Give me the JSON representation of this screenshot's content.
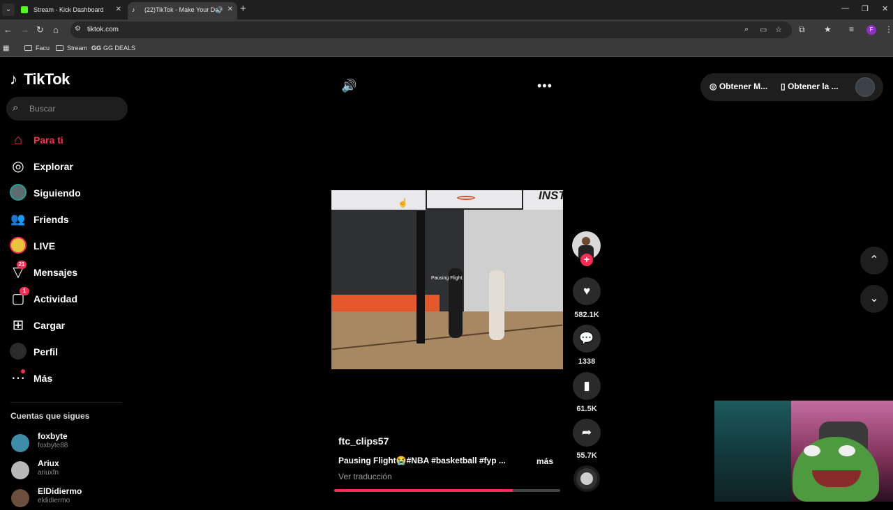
{
  "browser": {
    "tabs": [
      {
        "title": "Stream - Kick Dashboard",
        "favicon_color": "#53fc18",
        "active": false
      },
      {
        "title": "(22)TikTok - Make Your Day",
        "favicon_color": "#ffffff",
        "active": true
      }
    ],
    "url": "tiktok.com",
    "bookmarks": [
      {
        "label": "Facu",
        "icon": "folder-icon"
      },
      {
        "label": "Stream",
        "icon": "folder-icon"
      },
      {
        "label": "GG DEALS",
        "icon": "gg-icon"
      }
    ],
    "profile_initial": "F"
  },
  "sidebar": {
    "logo": "TikTok",
    "search_placeholder": "Buscar",
    "items": [
      {
        "label": "Para ti",
        "icon": "home-icon",
        "active": true
      },
      {
        "label": "Explorar",
        "icon": "compass-icon"
      },
      {
        "label": "Siguiendo",
        "icon": "following-avatar"
      },
      {
        "label": "Friends",
        "icon": "friends-icon"
      },
      {
        "label": "LIVE",
        "icon": "live-avatar"
      },
      {
        "label": "Mensajes",
        "icon": "send-icon",
        "badge": "21"
      },
      {
        "label": "Actividad",
        "icon": "activity-icon",
        "badge": "1"
      },
      {
        "label": "Cargar",
        "icon": "upload-icon"
      },
      {
        "label": "Perfil",
        "icon": "profile-avatar"
      },
      {
        "label": "Más",
        "icon": "more-icon"
      }
    ],
    "following_title": "Cuentas que sigues",
    "accounts": [
      {
        "name": "foxbyte",
        "username": "foxbyte88"
      },
      {
        "name": "Ariux",
        "username": "ariuxfn"
      },
      {
        "name": "ElDidiermo",
        "username": "eldidiermo"
      }
    ]
  },
  "header": {
    "get_coins": "Obtener M...",
    "get_app": "Obtener la ..."
  },
  "video": {
    "watermark": "INST",
    "overlay_caption": "Pausing Flight.",
    "author": "ftc_clips57",
    "description": "Pausing Flight😭#NBA #basketball #fyp ...",
    "more": "más",
    "translate": "Ver traducción",
    "progress": 0.79
  },
  "actions": {
    "likes": "582.1K",
    "comments": "1338",
    "saves": "61.5K",
    "shares": "55.7K"
  },
  "colors": {
    "accent": "#fe2c55",
    "background": "#000000"
  }
}
